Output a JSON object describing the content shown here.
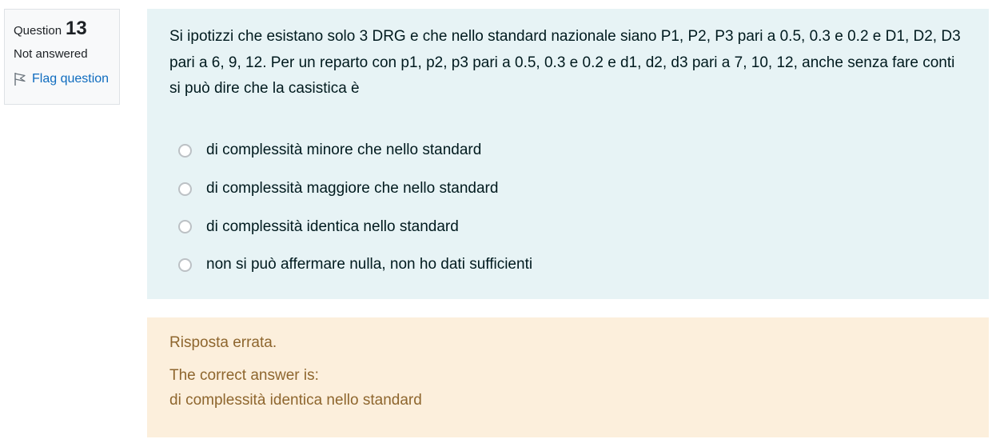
{
  "info": {
    "question_label": "Question",
    "question_number": "13",
    "state": "Not answered",
    "flag_label": "Flag question"
  },
  "question": {
    "text": "Si ipotizzi che esistano solo 3 DRG e che nello standard nazionale siano P1, P2, P3 pari a 0.5, 0.3 e 0.2 e D1, D2, D3 pari a 6, 9, 12. Per un reparto con p1, p2, p3 pari a 0.5, 0.3 e 0.2 e d1, d2, d3 pari a 7, 10, 12, anche senza fare conti si può dire che la casistica è",
    "options": [
      "di complessità minore che nello standard",
      "di complessità maggiore che nello standard",
      "di complessità identica nello standard",
      "non si può affermare nulla, non ho dati sufficienti"
    ]
  },
  "feedback": {
    "verdict": "Risposta errata.",
    "correct_label": "The correct answer is:",
    "correct_answer": "di complessità identica nello standard"
  },
  "colors": {
    "formulation_bg": "#e7f3f5",
    "outcome_bg": "#fcefdc",
    "outcome_text": "#8e662e",
    "link": "#0f6cbf"
  }
}
